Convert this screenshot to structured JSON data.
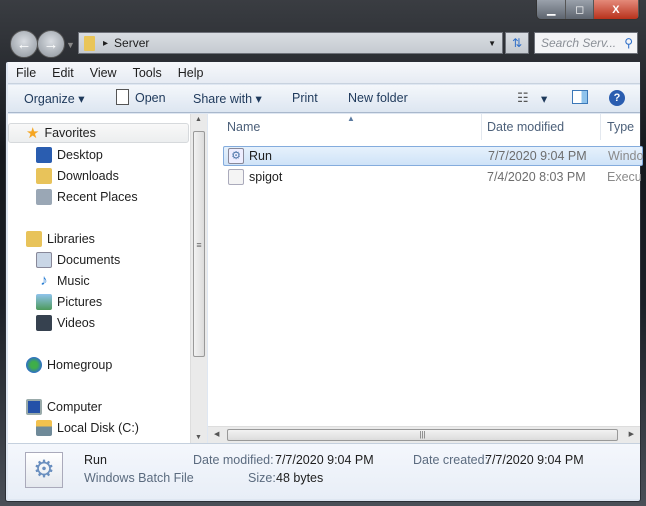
{
  "window": {
    "controls": {
      "minimize": "▁",
      "maximize": "◻",
      "close": "X"
    }
  },
  "address": {
    "path": "Server",
    "separator": "▸"
  },
  "search": {
    "placeholder": "Search Serv..."
  },
  "menu": [
    "File",
    "Edit",
    "View",
    "Tools",
    "Help"
  ],
  "toolbar": {
    "organize": "Organize ▾",
    "open": "Open",
    "share": "Share with ▾",
    "print": "Print",
    "new_folder": "New folder",
    "views": "▾"
  },
  "sidebar": {
    "items": [
      {
        "label": "Favorites",
        "icon": "star-icon",
        "color": "#f5a623"
      },
      {
        "label": "Desktop",
        "icon": "desktop-icon",
        "color": "#2a5db0"
      },
      {
        "label": "Downloads",
        "icon": "downloads-icon",
        "color": "#e8c35a"
      },
      {
        "label": "Recent Places",
        "icon": "recent-places-icon",
        "color": "#9aa7b5"
      },
      {
        "label": "Libraries",
        "icon": "libraries-icon",
        "color": "#e8c35a"
      },
      {
        "label": "Documents",
        "icon": "documents-icon",
        "color": "#c9d6e6"
      },
      {
        "label": "Music",
        "icon": "music-icon",
        "color": "#2b7fd3"
      },
      {
        "label": "Pictures",
        "icon": "pictures-icon",
        "color": "#4d9a5b"
      },
      {
        "label": "Videos",
        "icon": "videos-icon",
        "color": "#36414f"
      },
      {
        "label": "Homegroup",
        "icon": "homegroup-icon",
        "color": "#2f6fc8"
      },
      {
        "label": "Computer",
        "icon": "computer-icon",
        "color": "#2451a8"
      },
      {
        "label": "Local Disk (C:)",
        "icon": "local-disk-icon",
        "color": "#6f8a99"
      }
    ]
  },
  "columns": {
    "name": "Name",
    "date": "Date modified",
    "type": "Type"
  },
  "files": [
    {
      "name": "Run",
      "date": "7/7/2020 9:04 PM",
      "type": "Windo",
      "selected": true
    },
    {
      "name": "spigot",
      "date": "7/4/2020 8:03 PM",
      "type": "Execu",
      "selected": false
    }
  ],
  "details": {
    "name": "Run",
    "type": "Windows Batch File",
    "modified_label": "Date modified:",
    "modified": "7/7/2020 9:04 PM",
    "created_label": "Date created:",
    "created": "7/7/2020 9:04 PM",
    "size_label": "Size:",
    "size": "48 bytes"
  }
}
